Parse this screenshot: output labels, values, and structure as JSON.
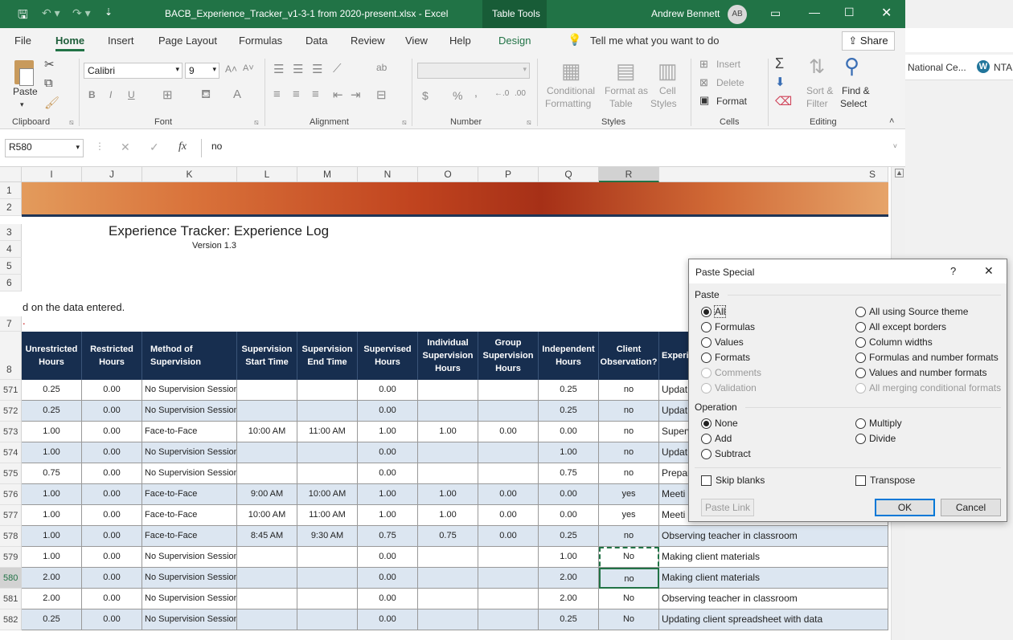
{
  "window": {
    "title": "BACB_Experience_Tracker_v1-3-1 from 2020-present.xlsx  -  Excel",
    "context_tab": "Table Tools",
    "user": "Andrew Bennett",
    "avatar": "AB"
  },
  "tabs": [
    "File",
    "Home",
    "Insert",
    "Page Layout",
    "Formulas",
    "Data",
    "Review",
    "View",
    "Help",
    "Design"
  ],
  "tell_me": "Tell me what you want to do",
  "share": "Share",
  "ribbon": {
    "clipboard": {
      "label": "Clipboard",
      "paste": "Paste"
    },
    "font": {
      "label": "Font",
      "name": "Calibri",
      "size": "9",
      "bold": "B",
      "italic": "I",
      "underline": "U"
    },
    "alignment": {
      "label": "Alignment"
    },
    "number": {
      "label": "Number",
      "currency": "$",
      "percent": "%",
      "comma": ","
    },
    "styles": {
      "label": "Styles",
      "cond1": "Conditional",
      "cond2": "Formatting",
      "fmt1": "Format as",
      "fmt2": "Table",
      "cell1": "Cell",
      "cell2": "Styles"
    },
    "cells": {
      "label": "Cells",
      "insert": "Insert",
      "delete": "Delete",
      "format": "Format"
    },
    "editing": {
      "label": "Editing",
      "sort1": "Sort &",
      "sort2": "Filter",
      "find1": "Find &",
      "find2": "Select"
    }
  },
  "formula_bar": {
    "name_box": "R580",
    "fx": "fx",
    "value": "no"
  },
  "browser": {
    "bookmark1": "National Ce...",
    "bookmark2": "NTA"
  },
  "columns": [
    "I",
    "J",
    "K",
    "L",
    "M",
    "N",
    "O",
    "P",
    "Q",
    "R",
    "S"
  ],
  "sheet": {
    "title": "Experience Tracker: Experience Log",
    "version": "Version 1.3",
    "note": "d on the data entered.",
    "red_mark": "."
  },
  "table_headers": [
    "Unrestricted Hours",
    "Restricted Hours",
    "Method of Supervision",
    "Supervision Start Time",
    "Supervision End Time",
    "Supervised Hours",
    "Individual Supervision Hours",
    "Group Supervision Hours",
    "Independent Hours",
    "Client Observation?",
    "Experie"
  ],
  "header_rows": [
    "1",
    "2",
    "3",
    "4",
    "5",
    "6",
    "7",
    "8"
  ],
  "rows": [
    {
      "n": "571",
      "c": [
        "0.25",
        "0.00",
        "No Supervision Session",
        "",
        "",
        "0.00",
        "",
        "",
        "0.25",
        "no",
        "Updat"
      ]
    },
    {
      "n": "572",
      "c": [
        "0.25",
        "0.00",
        "No Supervision Session",
        "",
        "",
        "0.00",
        "",
        "",
        "0.25",
        "no",
        "Updat"
      ]
    },
    {
      "n": "573",
      "c": [
        "1.00",
        "0.00",
        "Face-to-Face",
        "10:00 AM",
        "11:00 AM",
        "1.00",
        "1.00",
        "0.00",
        "0.00",
        "no",
        "Superv"
      ]
    },
    {
      "n": "574",
      "c": [
        "1.00",
        "0.00",
        "No Supervision Session",
        "",
        "",
        "0.00",
        "",
        "",
        "1.00",
        "no",
        "Updat"
      ]
    },
    {
      "n": "575",
      "c": [
        "0.75",
        "0.00",
        "No Supervision Session",
        "",
        "",
        "0.00",
        "",
        "",
        "0.75",
        "no",
        "Prepar"
      ]
    },
    {
      "n": "576",
      "c": [
        "1.00",
        "0.00",
        "Face-to-Face",
        "9:00 AM",
        "10:00 AM",
        "1.00",
        "1.00",
        "0.00",
        "0.00",
        "yes",
        "Meeti"
      ]
    },
    {
      "n": "577",
      "c": [
        "1.00",
        "0.00",
        "Face-to-Face",
        "10:00 AM",
        "11:00 AM",
        "1.00",
        "1.00",
        "0.00",
        "0.00",
        "yes",
        "Meeti"
      ]
    },
    {
      "n": "578",
      "c": [
        "1.00",
        "0.00",
        "Face-to-Face",
        "8:45 AM",
        "9:30 AM",
        "0.75",
        "0.75",
        "0.00",
        "0.25",
        "no",
        "Observing teacher in classroom"
      ]
    },
    {
      "n": "579",
      "c": [
        "1.00",
        "0.00",
        "No Supervision Session",
        "",
        "",
        "0.00",
        "",
        "",
        "1.00",
        "No",
        "Making client materials"
      ]
    },
    {
      "n": "580",
      "c": [
        "2.00",
        "0.00",
        "No Supervision Session",
        "",
        "",
        "0.00",
        "",
        "",
        "2.00",
        "no",
        "Making client materials"
      ]
    },
    {
      "n": "581",
      "c": [
        "2.00",
        "0.00",
        "No Supervision Session",
        "",
        "",
        "0.00",
        "",
        "",
        "2.00",
        "No",
        "Observing teacher in classroom"
      ]
    },
    {
      "n": "582",
      "c": [
        "0.25",
        "0.00",
        "No Supervision Session",
        "",
        "",
        "0.00",
        "",
        "",
        "0.25",
        "No",
        "Updating client spreadsheet with data"
      ]
    }
  ],
  "dialog": {
    "title": "Paste Special",
    "help": "?",
    "close": "✕",
    "paste_label": "Paste",
    "paste_left": [
      "All",
      "Formulas",
      "Values",
      "Formats",
      "Comments",
      "Validation"
    ],
    "paste_right": [
      "All using Source theme",
      "All except borders",
      "Column widths",
      "Formulas and number formats",
      "Values and number formats",
      "All merging conditional formats"
    ],
    "operation_label": "Operation",
    "op_left": [
      "None",
      "Add",
      "Subtract"
    ],
    "op_right": [
      "Multiply",
      "Divide"
    ],
    "skip_blanks": "Skip blanks",
    "transpose": "Transpose",
    "paste_link": "Paste Link",
    "ok": "OK",
    "cancel": "Cancel"
  }
}
